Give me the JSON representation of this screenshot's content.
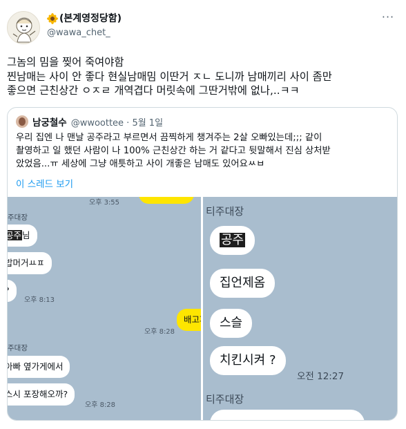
{
  "author": {
    "display_name": "(본계영정당함)",
    "handle": "@wawa_chet_"
  },
  "more_icon": "more-horizontal-icon",
  "tweet": {
    "text": "그놈의 밈을 찢어 죽여야함\n찐남매는 사이 안 좋다 현실남매밈 이딴거 ㅈㄴ 도니까 남매끼리 사이 좀만\n좋으면 근친상간 ㅇㅈㄹ 개역겹다 머릿속에 그딴거밖에 없나,..ㅋㅋ"
  },
  "quote": {
    "name": "남궁철수",
    "handle": "@wwoottee · 5월 1일",
    "text": "우리 집엔 나 맨날 공주라고 부르면서 끔찍하게 챙겨주는 2살 오빠있는데;;; 같이\n촬영하고 일 했던 사람이 나 100% 근친상간 하는 거 같다고 뒷말해서 진심 상처받\n았었음...ㅠ 세상에 그냥 애틋하고 사이 개좋은 남매도 있어요ㅆㅂ",
    "thread_link": "이 스레드 보기"
  },
  "chat_left": {
    "time_top": "오후 3:55",
    "sender1": "주대장",
    "msg1_hl": "공주",
    "msg1_rest": "님",
    "msg2": "밥머거ㅛㅍ",
    "msg3": "?",
    "time1": "오후 8:13",
    "mine": "배고파",
    "time_mine": "오후 8:28",
    "sender2": "주대장",
    "msg4": "아빠 옆가게에서",
    "msg5": "스시 포장해오까?",
    "time2": "오후 8:28"
  },
  "chat_right": {
    "sender1": "티주대장",
    "msg1": "공주",
    "msg2": "집언제옴",
    "msg3": "스슬",
    "msg4": "치킨시켜 ?",
    "time1": "오전 12:27",
    "sender2": "티주대장"
  }
}
